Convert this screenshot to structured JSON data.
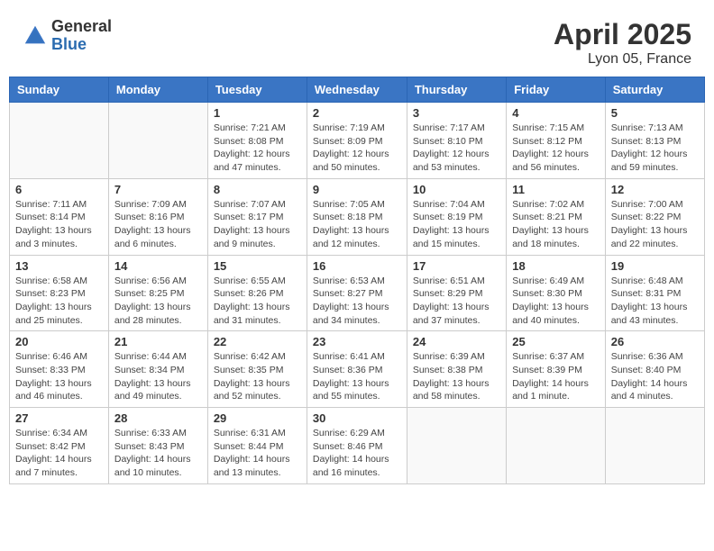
{
  "header": {
    "logo_general": "General",
    "logo_blue": "Blue",
    "month_title": "April 2025",
    "location": "Lyon 05, France"
  },
  "weekdays": [
    "Sunday",
    "Monday",
    "Tuesday",
    "Wednesday",
    "Thursday",
    "Friday",
    "Saturday"
  ],
  "weeks": [
    [
      {
        "day": "",
        "info": ""
      },
      {
        "day": "",
        "info": ""
      },
      {
        "day": "1",
        "info": "Sunrise: 7:21 AM\nSunset: 8:08 PM\nDaylight: 12 hours and 47 minutes."
      },
      {
        "day": "2",
        "info": "Sunrise: 7:19 AM\nSunset: 8:09 PM\nDaylight: 12 hours and 50 minutes."
      },
      {
        "day": "3",
        "info": "Sunrise: 7:17 AM\nSunset: 8:10 PM\nDaylight: 12 hours and 53 minutes."
      },
      {
        "day": "4",
        "info": "Sunrise: 7:15 AM\nSunset: 8:12 PM\nDaylight: 12 hours and 56 minutes."
      },
      {
        "day": "5",
        "info": "Sunrise: 7:13 AM\nSunset: 8:13 PM\nDaylight: 12 hours and 59 minutes."
      }
    ],
    [
      {
        "day": "6",
        "info": "Sunrise: 7:11 AM\nSunset: 8:14 PM\nDaylight: 13 hours and 3 minutes."
      },
      {
        "day": "7",
        "info": "Sunrise: 7:09 AM\nSunset: 8:16 PM\nDaylight: 13 hours and 6 minutes."
      },
      {
        "day": "8",
        "info": "Sunrise: 7:07 AM\nSunset: 8:17 PM\nDaylight: 13 hours and 9 minutes."
      },
      {
        "day": "9",
        "info": "Sunrise: 7:05 AM\nSunset: 8:18 PM\nDaylight: 13 hours and 12 minutes."
      },
      {
        "day": "10",
        "info": "Sunrise: 7:04 AM\nSunset: 8:19 PM\nDaylight: 13 hours and 15 minutes."
      },
      {
        "day": "11",
        "info": "Sunrise: 7:02 AM\nSunset: 8:21 PM\nDaylight: 13 hours and 18 minutes."
      },
      {
        "day": "12",
        "info": "Sunrise: 7:00 AM\nSunset: 8:22 PM\nDaylight: 13 hours and 22 minutes."
      }
    ],
    [
      {
        "day": "13",
        "info": "Sunrise: 6:58 AM\nSunset: 8:23 PM\nDaylight: 13 hours and 25 minutes."
      },
      {
        "day": "14",
        "info": "Sunrise: 6:56 AM\nSunset: 8:25 PM\nDaylight: 13 hours and 28 minutes."
      },
      {
        "day": "15",
        "info": "Sunrise: 6:55 AM\nSunset: 8:26 PM\nDaylight: 13 hours and 31 minutes."
      },
      {
        "day": "16",
        "info": "Sunrise: 6:53 AM\nSunset: 8:27 PM\nDaylight: 13 hours and 34 minutes."
      },
      {
        "day": "17",
        "info": "Sunrise: 6:51 AM\nSunset: 8:29 PM\nDaylight: 13 hours and 37 minutes."
      },
      {
        "day": "18",
        "info": "Sunrise: 6:49 AM\nSunset: 8:30 PM\nDaylight: 13 hours and 40 minutes."
      },
      {
        "day": "19",
        "info": "Sunrise: 6:48 AM\nSunset: 8:31 PM\nDaylight: 13 hours and 43 minutes."
      }
    ],
    [
      {
        "day": "20",
        "info": "Sunrise: 6:46 AM\nSunset: 8:33 PM\nDaylight: 13 hours and 46 minutes."
      },
      {
        "day": "21",
        "info": "Sunrise: 6:44 AM\nSunset: 8:34 PM\nDaylight: 13 hours and 49 minutes."
      },
      {
        "day": "22",
        "info": "Sunrise: 6:42 AM\nSunset: 8:35 PM\nDaylight: 13 hours and 52 minutes."
      },
      {
        "day": "23",
        "info": "Sunrise: 6:41 AM\nSunset: 8:36 PM\nDaylight: 13 hours and 55 minutes."
      },
      {
        "day": "24",
        "info": "Sunrise: 6:39 AM\nSunset: 8:38 PM\nDaylight: 13 hours and 58 minutes."
      },
      {
        "day": "25",
        "info": "Sunrise: 6:37 AM\nSunset: 8:39 PM\nDaylight: 14 hours and 1 minute."
      },
      {
        "day": "26",
        "info": "Sunrise: 6:36 AM\nSunset: 8:40 PM\nDaylight: 14 hours and 4 minutes."
      }
    ],
    [
      {
        "day": "27",
        "info": "Sunrise: 6:34 AM\nSunset: 8:42 PM\nDaylight: 14 hours and 7 minutes."
      },
      {
        "day": "28",
        "info": "Sunrise: 6:33 AM\nSunset: 8:43 PM\nDaylight: 14 hours and 10 minutes."
      },
      {
        "day": "29",
        "info": "Sunrise: 6:31 AM\nSunset: 8:44 PM\nDaylight: 14 hours and 13 minutes."
      },
      {
        "day": "30",
        "info": "Sunrise: 6:29 AM\nSunset: 8:46 PM\nDaylight: 14 hours and 16 minutes."
      },
      {
        "day": "",
        "info": ""
      },
      {
        "day": "",
        "info": ""
      },
      {
        "day": "",
        "info": ""
      }
    ]
  ]
}
